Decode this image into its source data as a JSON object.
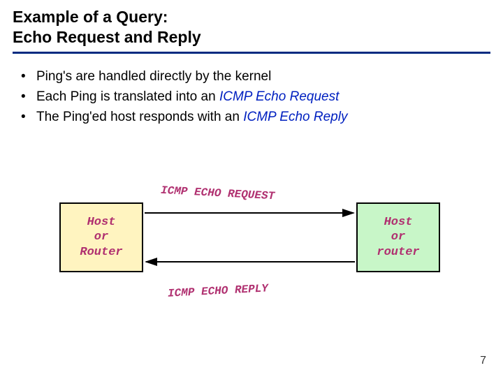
{
  "title_line1": "Example of a Query:",
  "title_line2": "Echo Request and Reply",
  "bullet1_a": "Ping's are handled directly by the kernel",
  "bullet2_a": "Each Ping is translated into an ",
  "bullet2_b": "ICMP Echo Request",
  "bullet3_a": "The Ping'ed host responds with an ",
  "bullet3_b": "ICMP Echo Reply",
  "box_left": "Host\nor\nRouter",
  "box_right": "Host\nor\nrouter",
  "label_request": "ICMP ECHO REQUEST",
  "label_reply": "ICMP ECHO REPLY",
  "page_number": "7"
}
